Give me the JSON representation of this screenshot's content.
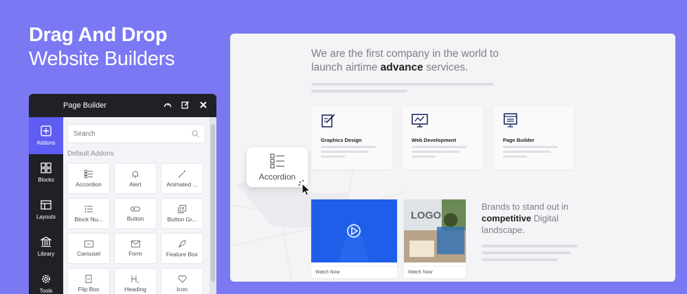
{
  "hero": {
    "line1": "Drag And Drop",
    "line2": "Website Builders"
  },
  "panel": {
    "title": "Page Builder",
    "header_icons": [
      "gauge-icon",
      "edit-icon",
      "close-icon"
    ],
    "sidebar": [
      {
        "label": "Addons",
        "icon": "plus-square-icon",
        "active": true
      },
      {
        "label": "Blocks",
        "icon": "blocks-icon",
        "active": false
      },
      {
        "label": "Layouts",
        "icon": "layouts-icon",
        "active": false
      },
      {
        "label": "Library",
        "icon": "library-icon",
        "active": false
      },
      {
        "label": "Tools",
        "icon": "gear-icon",
        "active": false
      }
    ],
    "search_placeholder": "Search",
    "section_label": "Default Addons",
    "addons": [
      {
        "label": "Accordion",
        "icon": "accordion-icon"
      },
      {
        "label": "Alert",
        "icon": "bell-icon"
      },
      {
        "label": "Animated ...",
        "icon": "magic-wand-icon"
      },
      {
        "label": "Block Nu...",
        "icon": "block-number-icon"
      },
      {
        "label": "Button",
        "icon": "button-icon"
      },
      {
        "label": "Button Gr...",
        "icon": "button-group-icon"
      },
      {
        "label": "Carousel",
        "icon": "carousel-icon"
      },
      {
        "label": "Form",
        "icon": "envelope-icon"
      },
      {
        "label": "Feature Box",
        "icon": "rocket-icon"
      },
      {
        "label": "Flip Box",
        "icon": "flip-box-icon"
      },
      {
        "label": "Heading",
        "icon": "heading-icon"
      },
      {
        "label": "Icon",
        "icon": "heart-icon"
      }
    ]
  },
  "site": {
    "headline_pre": "We are the first company in the world to",
    "headline_mid": "launch airtime ",
    "headline_bold": "advance",
    "headline_post": " services.",
    "services": [
      {
        "title": "Graphics Design",
        "icon": "graphics-design-icon"
      },
      {
        "title": "Web Development",
        "icon": "web-development-icon"
      },
      {
        "title": "Page Builder",
        "icon": "page-builder-icon"
      }
    ],
    "videos": [
      {
        "caption": "Watch Now",
        "thumb": "play-video"
      },
      {
        "caption": "Watch Now",
        "thumb": "logo-photo"
      }
    ],
    "photo_text": "LOGO",
    "brands_pre": "Brands to stand out in",
    "brands_bold": "competitive",
    "brands_post": " Digital",
    "brands_last": "landscape."
  },
  "drag_chip": {
    "label": "Accordion",
    "icon": "accordion-icon"
  },
  "colors": {
    "background": "#7b78f4",
    "accent": "#5f5df2",
    "panel_dark": "#1f2127",
    "video_blue": "#1f5ee8",
    "icon_navy": "#1b2b5e"
  }
}
